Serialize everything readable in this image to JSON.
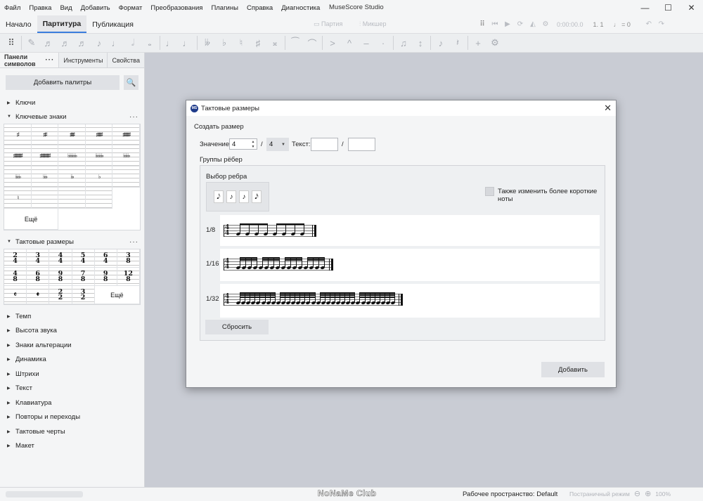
{
  "app": {
    "title": "MuseScore Studio",
    "menu": [
      "Файл",
      "Правка",
      "Вид",
      "Добавить",
      "Формат",
      "Преобразования",
      "Плагины",
      "Справка",
      "Диагностика"
    ],
    "window_controls": [
      "—",
      "☐",
      "✕"
    ]
  },
  "workspace_tabs": [
    "Начало",
    "Партитура",
    "Публикация"
  ],
  "top_toolbar": {
    "playback_label": "Партия",
    "mixer_label": "Микшер",
    "time_display": "0:00:00.0",
    "position_display": "1. 1",
    "tempo_display": "♩ = 0"
  },
  "left_panel": {
    "tabs": [
      "Панели символов",
      "Инструменты",
      "Свойства"
    ],
    "tab_more": "···",
    "add_palette_label": "Добавить палитры",
    "search_icon": "🔍",
    "more_label": "Ещё",
    "palettes": [
      {
        "label": "Ключи",
        "expanded": false
      },
      {
        "label": "Ключевые знаки",
        "expanded": true
      },
      {
        "label": "Тактовые размеры",
        "expanded": true
      },
      {
        "label": "Темп",
        "expanded": false
      },
      {
        "label": "Высота звука",
        "expanded": false
      },
      {
        "label": "Знаки альтерации",
        "expanded": false
      },
      {
        "label": "Динамика",
        "expanded": false
      },
      {
        "label": "Штрихи",
        "expanded": false
      },
      {
        "label": "Текст",
        "expanded": false
      },
      {
        "label": "Клавиатура",
        "expanded": false
      },
      {
        "label": "Повторы и переходы",
        "expanded": false
      },
      {
        "label": "Тактовые черты",
        "expanded": false
      },
      {
        "label": "Макет",
        "expanded": false
      }
    ],
    "key_signatures": [
      "♯",
      "♯♯",
      "♯♯♯",
      "♯♯♯♯",
      "♯♯♯♯♯",
      "♯♯♯♯♯♯",
      "♯♯♯♯♯♯♯",
      "♭♭♭♭♭♭♭",
      "♭♭♭♭♭♭",
      "♭♭♭♭♭",
      "♭♭♭♭",
      "♭♭♭",
      "♭♭",
      "♭",
      "",
      "♮",
      "",
      "",
      ""
    ],
    "time_signatures": [
      {
        "num": "2",
        "den": "4"
      },
      {
        "num": "3",
        "den": "4"
      },
      {
        "num": "4",
        "den": "4"
      },
      {
        "num": "5",
        "den": "4"
      },
      {
        "num": "6",
        "den": "4"
      },
      {
        "num": "3",
        "den": "8"
      },
      {
        "num": "4",
        "den": "8"
      },
      {
        "num": "6",
        "den": "8"
      },
      {
        "num": "9",
        "den": "8"
      },
      {
        "num": "7",
        "den": "8"
      },
      {
        "num": "9",
        "den": "8"
      },
      {
        "num": "12",
        "den": "8"
      },
      {
        "num": "𝄴",
        "den": ""
      },
      {
        "num": "𝄵",
        "den": ""
      },
      {
        "num": "2",
        "den": "2"
      },
      {
        "num": "3",
        "den": "2"
      }
    ]
  },
  "dialog": {
    "title": "Тактовые размеры",
    "logo": "MS",
    "close": "✕",
    "create_section": "Создать размер",
    "value_label": "Значение:",
    "numerator": "4",
    "slash": "/",
    "denominator": "4",
    "text_label": "Текст:",
    "text_num": "",
    "text_den": "",
    "groups_section": "Группы рёбер",
    "beam_choice_label": "Выбор ребра",
    "beam_icons": [
      "𝅘𝅥𝅮",
      "♪",
      "♪",
      "𝅘𝅥𝅯"
    ],
    "checkbox_label": "Также изменить более короткие ноты",
    "rows": [
      {
        "label": "1/8",
        "notes": 8,
        "beam_group": 4
      },
      {
        "label": "1/16",
        "notes": 16,
        "beam_group": 4
      },
      {
        "label": "1/32",
        "notes": 32,
        "beam_group": 8
      }
    ],
    "reset_label": "Сбросить",
    "add_label": "Добавить"
  },
  "status_bar": {
    "watermark": "NoNaMe Club",
    "workspace": "Рабочее пространство: Default",
    "view_mode": "Постраничный режим",
    "zoom": "100%"
  }
}
